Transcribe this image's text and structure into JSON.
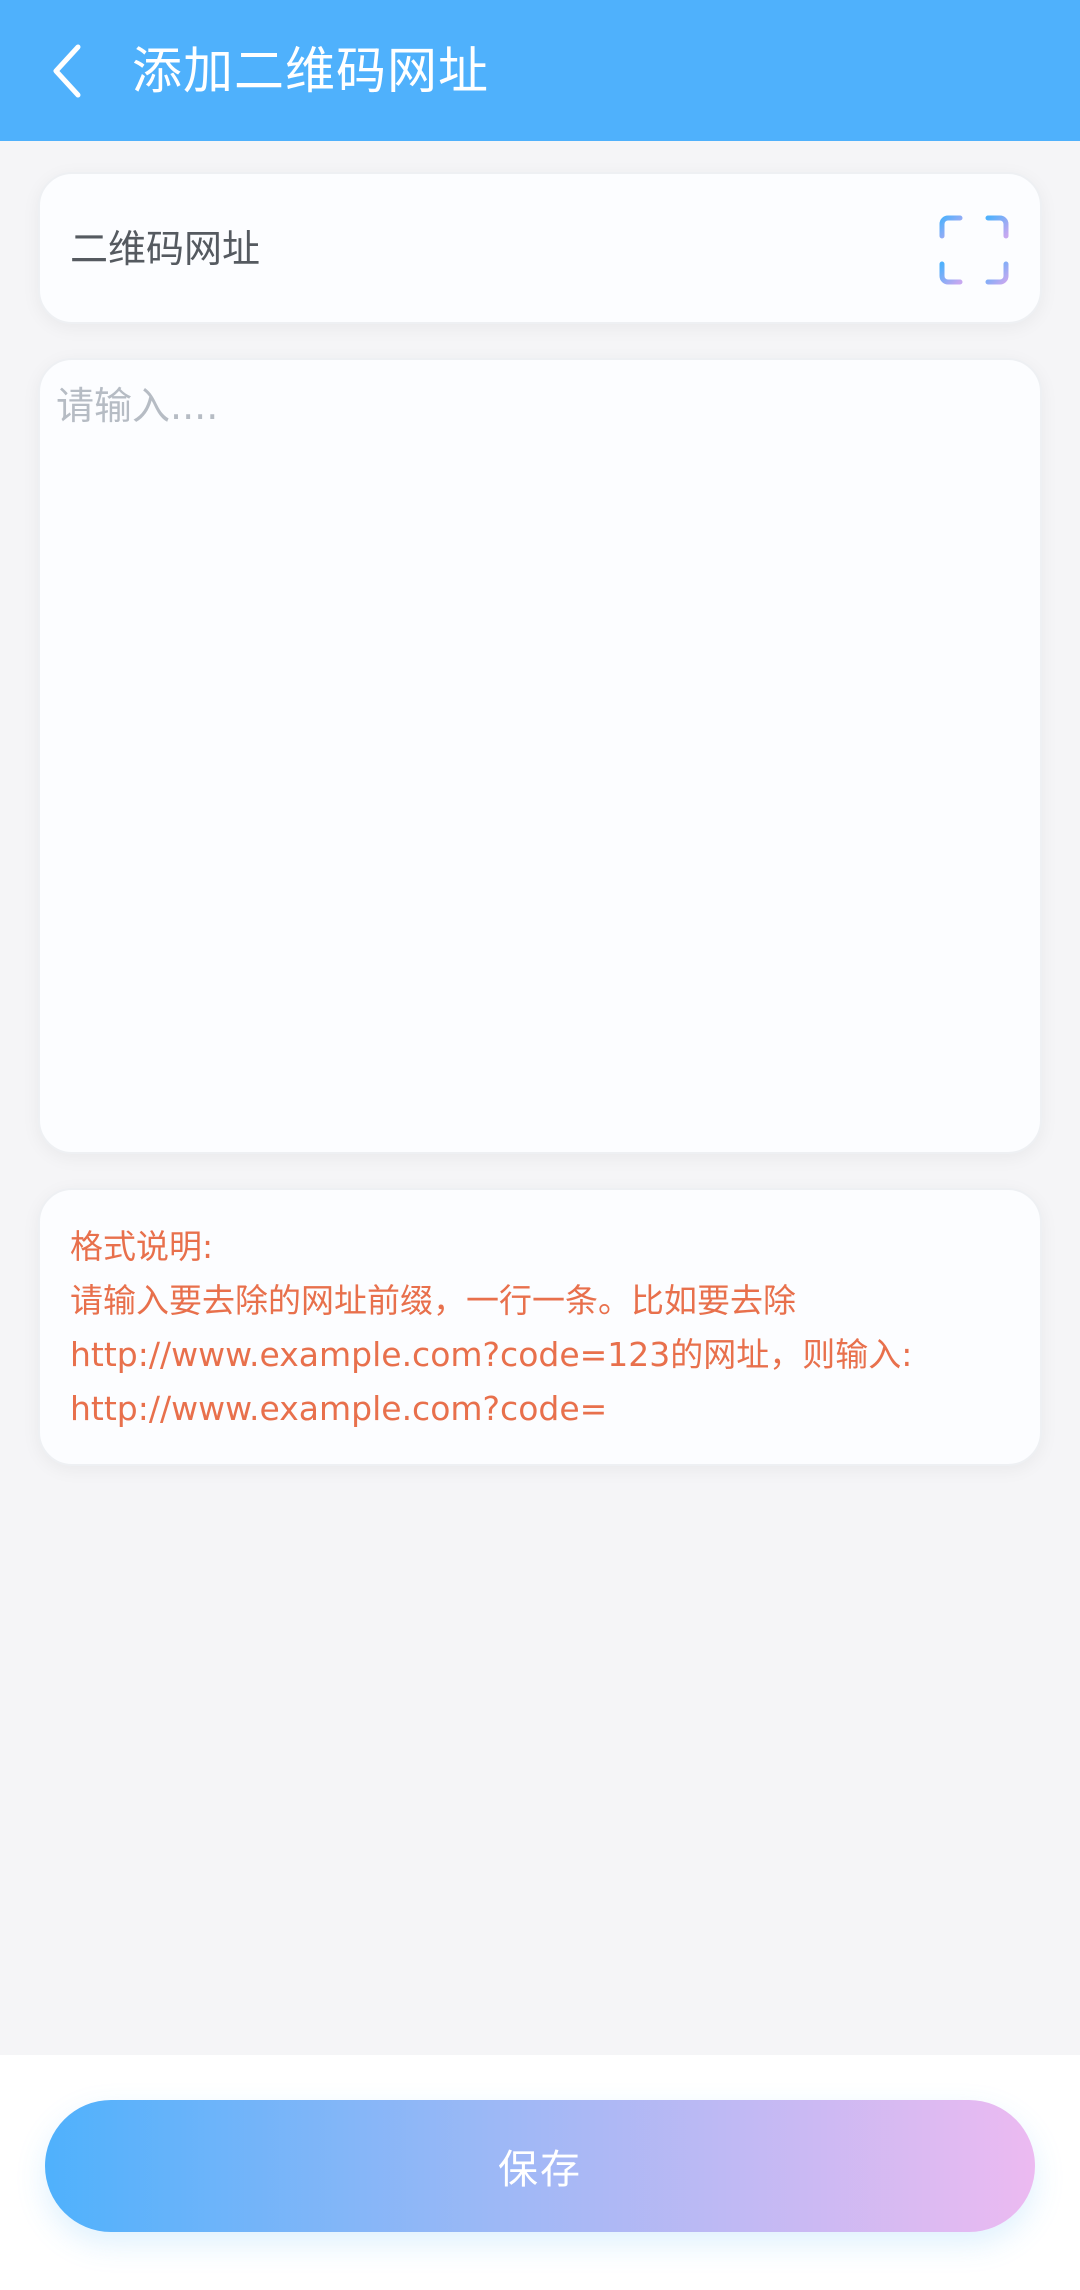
{
  "header": {
    "title": "添加二维码网址"
  },
  "qr_field": {
    "label": "二维码网址"
  },
  "input": {
    "placeholder": "请输入....",
    "value": ""
  },
  "help": {
    "lines": [
      "格式说明:",
      "请输入要去除的网址前缀，一行一条。比如要去除",
      "http://www.example.com?code=123的网址，则输入:",
      "http://www.example.com?code="
    ]
  },
  "footer": {
    "save_label": "保存"
  },
  "colors": {
    "header_bg": "#4fb1fc",
    "help_text": "#e8704c",
    "button_gradient_start": "#4fb1fc",
    "button_gradient_end": "#ecbaf1"
  },
  "icons": {
    "back": "chevron-left-icon",
    "scan": "scan-icon"
  }
}
